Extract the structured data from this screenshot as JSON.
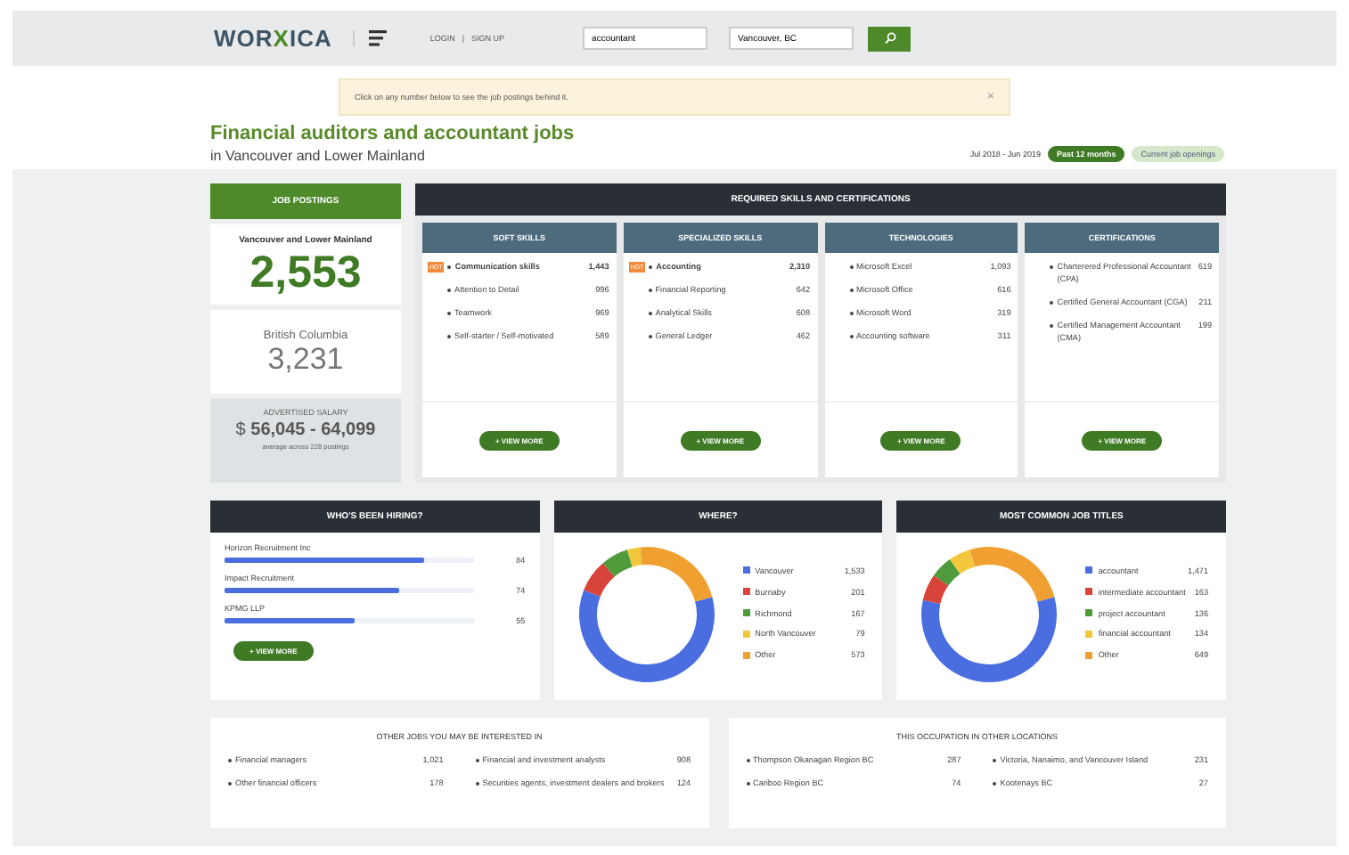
{
  "header": {
    "logo_left": "WOR",
    "logo_mid": "X",
    "logo_right": "ICA",
    "links": [
      "LOGIN",
      "SIGN UP"
    ],
    "separator": "|",
    "search": {
      "value": "accountant"
    },
    "location": {
      "value": "Vancouver, BC"
    }
  },
  "notice": {
    "text": "Click on any number below to see the job postings behind it.",
    "close": "×"
  },
  "title": "Financial auditors and accountant jobs",
  "subtitle_prefix": "in",
  "subtitle": "Vancouver and Lower Mainland",
  "period": {
    "range": "Jul 2018 - Jun 2019",
    "toggles": [
      {
        "label": "Past 12 months",
        "selected": true
      },
      {
        "label": "Current job openings",
        "selected": false
      }
    ]
  },
  "postings": {
    "title": "JOB POSTINGS",
    "region": "Vancouver and Lower Mainland",
    "region_count": "2,553",
    "province": "British Columbia",
    "province_count": "3,231",
    "salary_label": "ADVERTISED SALARY",
    "salary_currency": "$",
    "salary": "56,045 - 64,099",
    "salary_note": "average across 228 postings"
  },
  "skills": {
    "title": "REQUIRED SKILLS AND CERTIFICATIONS",
    "columns": [
      {
        "title": "SOFT SKILLS",
        "button": "+ VIEW MORE",
        "items": [
          {
            "label": "Communication skills",
            "count": "1,443",
            "badge": "HOT"
          },
          {
            "label": "Attention to Detail",
            "count": "996"
          },
          {
            "label": "Teamwork",
            "count": "969"
          },
          {
            "label": "Self-starter / Self-motivated",
            "count": "589"
          }
        ]
      },
      {
        "title": "SPECIALIZED SKILLS",
        "button": "+ VIEW MORE",
        "items": [
          {
            "label": "Accounting",
            "count": "2,310",
            "badge": "HOT"
          },
          {
            "label": "Financial Reporting",
            "count": "642"
          },
          {
            "label": "Analytical Skills",
            "count": "608"
          },
          {
            "label": "General Ledger",
            "count": "462"
          }
        ]
      },
      {
        "title": "TECHNOLOGIES",
        "button": "+ VIEW MORE",
        "items": [
          {
            "label": "Microsoft Excel",
            "count": "1,093"
          },
          {
            "label": "Microsoft Office",
            "count": "616"
          },
          {
            "label": "Microsoft Word",
            "count": "319"
          },
          {
            "label": "Accounting software",
            "count": "311"
          }
        ]
      },
      {
        "title": "CERTIFICATIONS",
        "button": "+ VIEW MORE",
        "items": [
          {
            "label": "Charterered Professional Accountant (CPA)",
            "count": "619"
          },
          {
            "label": "Certified General Accountant (CGA)",
            "count": "211"
          },
          {
            "label": "Certified Management Accountant (CMA)",
            "count": "199"
          }
        ]
      }
    ]
  },
  "hiring": {
    "title": "WHO'S BEEN HIRING?",
    "button": "+ VIEW MORE",
    "employers": [
      {
        "name": "Horizon Recruitment Inc",
        "count": "84",
        "level": 0.8
      },
      {
        "name": "Impact Recruitment",
        "count": "74",
        "level": 0.7
      },
      {
        "name": "KPMG LLP",
        "count": "55",
        "level": 0.52
      }
    ]
  },
  "where": {
    "title": "WHERE?",
    "legend": [
      {
        "count": "1,533",
        "color": "#4a6ee0"
      },
      {
        "count": "201",
        "color": "#d9443a"
      },
      {
        "count": "167",
        "color": "#4f9a3a"
      },
      {
        "count": "79",
        "color": "#f2c73c"
      },
      {
        "count": "573",
        "color": "#f0a030"
      }
    ],
    "chart_data": {
      "type": "donut",
      "categories": [
        "Vancouver",
        "Burnaby",
        "Richmond",
        "North Vancouver",
        "Other"
      ],
      "values": [
        60.06,
        7.87,
        6.54,
        3.09,
        22.44
      ]
    }
  },
  "titles": {
    "title": "MOST COMMON JOB TITLES",
    "legend": [
      {
        "count": "1,471",
        "color": "#4a6ee0"
      },
      {
        "count": "163",
        "color": "#d9443a"
      },
      {
        "count": "136",
        "color": "#4f9a3a"
      },
      {
        "count": "134",
        "color": "#f2c73c"
      },
      {
        "count": "649",
        "color": "#f0a030"
      }
    ],
    "chart_data": {
      "type": "donut",
      "categories": [
        "accountant",
        "intermediate accountant",
        "project accountant",
        "financial accountant",
        "Other"
      ],
      "values": [
        57.62,
        6.38,
        5.33,
        5.25,
        25.42
      ]
    }
  },
  "other_jobs": {
    "title": "OTHER JOBS YOU MAY BE INTERESTED IN",
    "items": [
      {
        "label": "Financial managers",
        "count": "1,021"
      },
      {
        "label": "Financial and investment analysts",
        "count": "908"
      },
      {
        "label": "Other financial officers",
        "count": "178"
      },
      {
        "label": "Securities agents, investment dealers and brokers",
        "count": "124"
      }
    ]
  },
  "other_locations": {
    "title": "THIS OCCUPATION IN OTHER LOCATIONS",
    "items": [
      {
        "label": "Thompson Okanagan Region BC",
        "count": "287"
      },
      {
        "label": "Victoria, Nanaimo, and Vancouver Island",
        "count": "231"
      },
      {
        "label": "Cariboo Region BC",
        "count": "74"
      },
      {
        "label": "Kootenays BC",
        "count": "27"
      }
    ]
  }
}
